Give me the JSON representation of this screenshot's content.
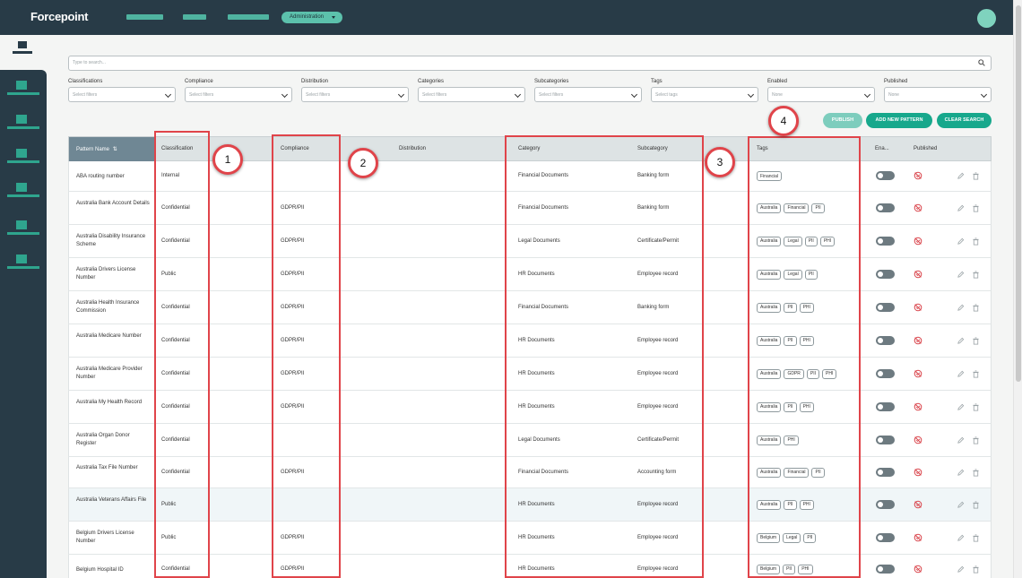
{
  "app": {
    "logo": "Forcepoint",
    "admin_label": "Administration"
  },
  "search": {
    "placeholder": "Type to search..."
  },
  "filters": [
    {
      "label": "Classifications",
      "placeholder": "Select filters"
    },
    {
      "label": "Compliance",
      "placeholder": "Select filters"
    },
    {
      "label": "Distribution",
      "placeholder": "Select filters"
    },
    {
      "label": "Categories",
      "placeholder": "Select filters"
    },
    {
      "label": "Subcategories",
      "placeholder": "Select filters"
    },
    {
      "label": "Tags",
      "placeholder": "Select tags"
    },
    {
      "label": "Enabled",
      "placeholder": "None"
    },
    {
      "label": "Published",
      "placeholder": "None"
    }
  ],
  "actions": {
    "publish": "PUBLISH",
    "add": "ADD NEW PATTERN",
    "clear": "CLEAR SEARCH"
  },
  "table": {
    "headers": {
      "name": "Pattern Name",
      "sort": "⇅",
      "classification": "Classification",
      "compliance": "Compliance",
      "distribution": "Distribution",
      "category": "Category",
      "subcategory": "Subcategory",
      "tags": "Tags",
      "enabled": "Ena...",
      "published": "Published"
    },
    "rows": [
      {
        "name": "ABA routing number",
        "classification": "Internal",
        "compliance": "",
        "category": "Financial Documents",
        "subcategory": "Banking form",
        "tags": [
          "Financial"
        ]
      },
      {
        "name": "Australia Bank Account Details",
        "classification": "Confidential",
        "compliance": "GDPR/PII",
        "category": "Financial Documents",
        "subcategory": "Banking form",
        "tags": [
          "Australia",
          "Financial",
          "PII"
        ]
      },
      {
        "name": "Australia Disability Insurance Scheme",
        "classification": "Confidential",
        "compliance": "GDPR/PII",
        "category": "Legal Documents",
        "subcategory": "Certificate/Permit",
        "tags": [
          "Australia",
          "Legal",
          "PII",
          "PHI"
        ]
      },
      {
        "name": "Australia Drivers License Number",
        "classification": "Public",
        "compliance": "GDPR/PII",
        "category": "HR Documents",
        "subcategory": "Employee record",
        "tags": [
          "Australia",
          "Legal",
          "PII"
        ]
      },
      {
        "name": "Australia Health Insurance Commission",
        "classification": "Confidential",
        "compliance": "GDPR/PII",
        "category": "Financial Documents",
        "subcategory": "Banking form",
        "tags": [
          "Australia",
          "PII",
          "PHI"
        ]
      },
      {
        "name": "Australia Medicare Number",
        "classification": "Confidential",
        "compliance": "GDPR/PII",
        "category": "HR Documents",
        "subcategory": "Employee record",
        "tags": [
          "Australia",
          "PII",
          "PHI"
        ]
      },
      {
        "name": "Australia Medicare Provider Number",
        "classification": "Confidential",
        "compliance": "GDPR/PII",
        "category": "HR Documents",
        "subcategory": "Employee record",
        "tags": [
          "Australia",
          "GDPR",
          "PII",
          "PHI"
        ]
      },
      {
        "name": "Australia My Health Record",
        "classification": "Confidential",
        "compliance": "GDPR/PII",
        "category": "HR Documents",
        "subcategory": "Employee record",
        "tags": [
          "Australia",
          "PII",
          "PHI"
        ]
      },
      {
        "name": "Australia Organ Donor Register",
        "classification": "Confidential",
        "compliance": "",
        "category": "Legal Documents",
        "subcategory": "Certificate/Permit",
        "tags": [
          "Australia",
          "PHI"
        ]
      },
      {
        "name": "Australia Tax File Number",
        "classification": "Confidential",
        "compliance": "GDPR/PII",
        "category": "Financial Documents",
        "subcategory": "Accounting form",
        "tags": [
          "Australia",
          "Financial",
          "PII"
        ]
      },
      {
        "name": "Australia Veterans Affairs File",
        "classification": "Public",
        "compliance": "",
        "category": "HR Documents",
        "subcategory": "Employee record",
        "tags": [
          "Australia",
          "PII",
          "PHI"
        ]
      },
      {
        "name": "Belgium Drivers License Number",
        "classification": "Public",
        "compliance": "GDPR/PII",
        "category": "HR Documents",
        "subcategory": "Employee record",
        "tags": [
          "Belgium",
          "Legal",
          "PII"
        ]
      },
      {
        "name": "Belgium Hospital ID",
        "classification": "Confidential",
        "compliance": "GDPR/PII",
        "category": "HR Documents",
        "subcategory": "Employee record",
        "tags": [
          "Belgium",
          "PII",
          "PHI"
        ]
      }
    ]
  },
  "callouts": [
    "1",
    "2",
    "3",
    "4"
  ],
  "colors": {
    "topbar": "#283b47",
    "accent": "#17a88c",
    "annotation": "#e0444a"
  }
}
